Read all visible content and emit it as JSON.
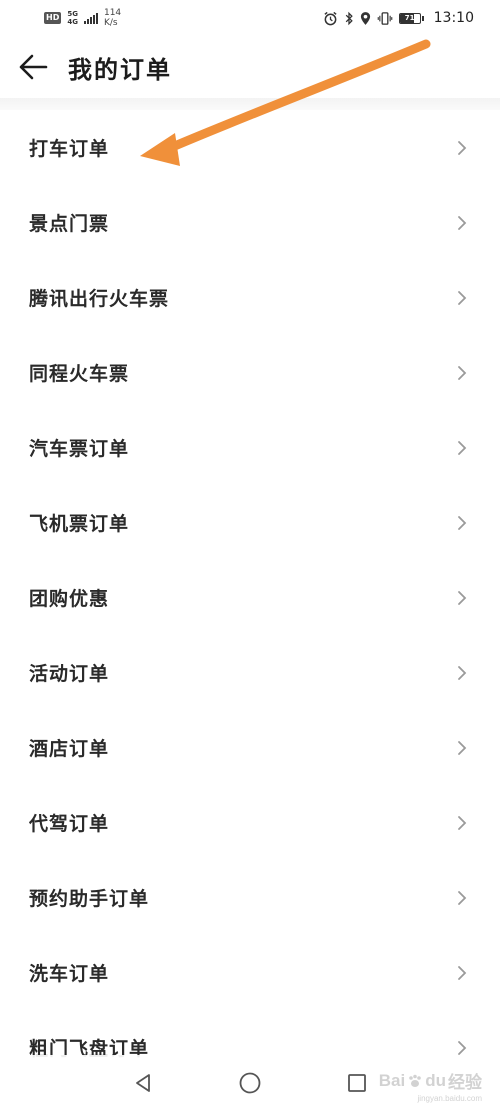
{
  "status_bar": {
    "hd": "HD",
    "network_gen_top": "5G",
    "network_gen_bottom": "4G",
    "speed_value": "114",
    "speed_unit": "K/s",
    "battery_level": "71",
    "battery_fraction": 0.71,
    "time": "13:10",
    "icons": [
      "alarm-icon",
      "bluetooth-icon",
      "location-icon",
      "vibrate-icon",
      "battery-icon"
    ]
  },
  "header": {
    "title": "我的订单",
    "back_icon": "arrow-left-icon"
  },
  "orders": [
    {
      "label": "打车订单"
    },
    {
      "label": "景点门票"
    },
    {
      "label": "腾讯出行火车票"
    },
    {
      "label": "同程火车票"
    },
    {
      "label": "汽车票订单"
    },
    {
      "label": "飞机票订单"
    },
    {
      "label": "团购优惠"
    },
    {
      "label": "活动订单"
    },
    {
      "label": "酒店订单"
    },
    {
      "label": "代驾订单"
    },
    {
      "label": "预约助手订单"
    },
    {
      "label": "洗车订单"
    },
    {
      "label": "粗门飞盘订单"
    }
  ],
  "annotation": {
    "color": "#f0903a"
  },
  "nav_bar": {
    "icons": [
      "back-triangle-icon",
      "home-circle-icon",
      "recents-square-icon"
    ]
  },
  "watermark": {
    "main": "Bai",
    "main_suffix": "du",
    "cn": "经验",
    "sub": "jingyan.baidu.com"
  }
}
